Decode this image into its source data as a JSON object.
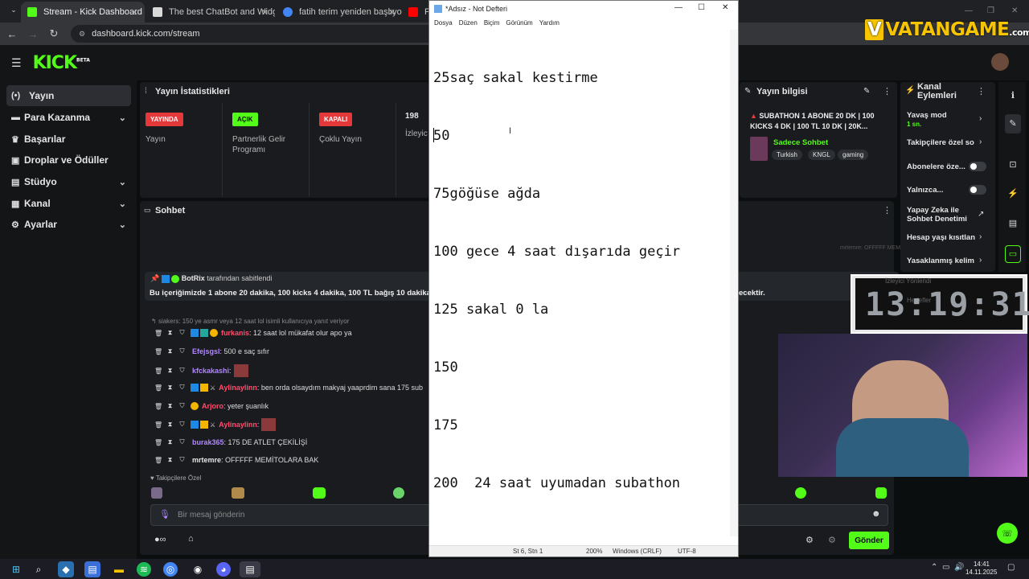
{
  "browser": {
    "tabs": [
      {
        "label": "Stream - Kick Dashboard",
        "active": true
      },
      {
        "label": "The best ChatBot and Widgets",
        "active": false
      },
      {
        "label": "fatih terim yeniden başlıyoruz",
        "active": false
      },
      {
        "label": "Fa",
        "active": false
      }
    ],
    "url": "dashboard.kick.com/stream"
  },
  "kick": {
    "logo": "KICK",
    "logo_badge": "BETA",
    "sidebar": [
      {
        "label": "Yayın",
        "icon": "broadcast-icon",
        "active": true,
        "chevron": false
      },
      {
        "label": "Para Kazanma",
        "icon": "money-icon",
        "active": false,
        "chevron": true
      },
      {
        "label": "Başarılar",
        "icon": "trophy-icon",
        "active": false,
        "chevron": false
      },
      {
        "label": "Droplar ve Ödüller",
        "icon": "gift-icon",
        "active": false,
        "chevron": false
      },
      {
        "label": "Stüdyo",
        "icon": "studio-icon",
        "active": false,
        "chevron": true
      },
      {
        "label": "Kanal",
        "icon": "channel-icon",
        "active": false,
        "chevron": true
      },
      {
        "label": "Ayarlar",
        "icon": "gear-icon",
        "active": false,
        "chevron": true
      }
    ],
    "stats": {
      "title": "Yayın İstatistikleri",
      "cards": [
        {
          "badge": "YAYINDA",
          "label": "Yayın",
          "color": "#e5383b"
        },
        {
          "badge": "AÇIK",
          "label": "Partnerlik Gelir Programı",
          "color": "#53fc18"
        },
        {
          "badge": "KAPALI",
          "label": "Çoklu Yayın",
          "color": "#e5383b"
        }
      ],
      "viewers_value": "198",
      "viewers_label": "İzleyic"
    },
    "chat": {
      "title": "Sohbet",
      "pinned_by": "BotRix",
      "pinned_suffix": "tarafından sabitlendi",
      "pinned_text": "Bu içeriğimizde 1 abone 20 dakika, 100 kicks 4 dakika, 100 TL bağış 10 dakika",
      "pinned_tail": "ecektir.",
      "reply_hint": "siakers: 150 ye asmr veya 12 saat lol isimli kullanıcıya yanıt veriyor",
      "messages": [
        {
          "user": "furkanis",
          "color": "#ff4d6d",
          "text": ": 12 saat lol mükafat olur apo ya",
          "emote": false
        },
        {
          "user": "Efejsgsl",
          "color": "#b388ff",
          "text": ": 500 e saç sıfır",
          "emote": false
        },
        {
          "user": "kfckakashi",
          "color": "#b388ff",
          "text": ":",
          "emote": true
        },
        {
          "user": "Aylinaylinn",
          "color": "#ff4d6d",
          "text": ": ben orda olsaydım makyaj yaaprdim sana 175 sub",
          "emote": false
        },
        {
          "user": "Arjoro",
          "color": "#ff4d6d",
          "text": ": yeter şuanlık",
          "emote": false
        },
        {
          "user": "Aylinaylinn",
          "color": "#ff4d6d",
          "text": ":",
          "emote": true
        },
        {
          "user": "burak365",
          "color": "#b388ff",
          "text": ": 175 DE ATLET ÇEKİLİŞİ",
          "emote": false
        },
        {
          "user": "mrtemre",
          "color": "#e6e6e6",
          "text": ": OFFFFF MEMİTOLARA BAK",
          "emote": false
        }
      ],
      "followers_only": "Takipçilere Özel",
      "input_placeholder": "Bir mesaj gönderin",
      "send_label": "Gönder",
      "infinity_label": "∞",
      "overlay_text": "mrtemre: OFFFFF MEMİTOLARA BAK"
    },
    "stream_info": {
      "title": "Yayın bilgisi",
      "stream_title": "SUBATHON 1 ABONE 20 DK | 100 KICKS 4 DK | 100 TL 10 DK | 20K...",
      "category": "Sadece Sohbet",
      "tags": [
        "Turkish",
        "KNGL",
        "gaming"
      ]
    },
    "channel_actions": {
      "title": "Kanal Eylemleri",
      "rows": [
        {
          "label": "Yavaş mod",
          "sub": "1 sn.",
          "control": "chevron"
        },
        {
          "label": "Takipçilere özel so",
          "sub": "",
          "control": "chevron"
        },
        {
          "label": "Abonelere öze...",
          "sub": "",
          "control": "toggle"
        },
        {
          "label": "Yalnızca...",
          "sub": "",
          "control": "toggle"
        },
        {
          "label": "Yapay Zeka ile Sohbet Denetimi",
          "sub": "",
          "control": "external"
        },
        {
          "label": "Hesap yaşı kısıtlan",
          "sub": "",
          "control": "chevron"
        },
        {
          "label": "Yasaklanmış kelim",
          "sub": "",
          "control": "chevron"
        }
      ]
    },
    "overlay": {
      "brand": "VATANGAME",
      "brand_prefix": "V",
      "brand_suffix": ".com",
      "timer": "13:19:31",
      "ghost_viewer": "İzleyici Yönlendi",
      "ghost_text": "Hedefler"
    }
  },
  "notepad": {
    "title": "*Adsız - Not Defteri",
    "menu": [
      "Dosya",
      "Düzen",
      "Biçim",
      "Görünüm",
      "Yardım"
    ],
    "lines": [
      "25saç sakal kestirme",
      "50",
      "75göğüse ağda",
      "100 gece 4 saat dışarıda geçir",
      "125 sakal 0 la",
      "150",
      "175",
      "200  24 saat uyumadan subathon"
    ],
    "status": {
      "position": "St 6, Stn 1",
      "zoom": "200%",
      "line_ending": "Windows (CRLF)",
      "encoding": "UTF-8"
    }
  },
  "taskbar": {
    "time": "14:41",
    "date": "14.11.2025"
  }
}
